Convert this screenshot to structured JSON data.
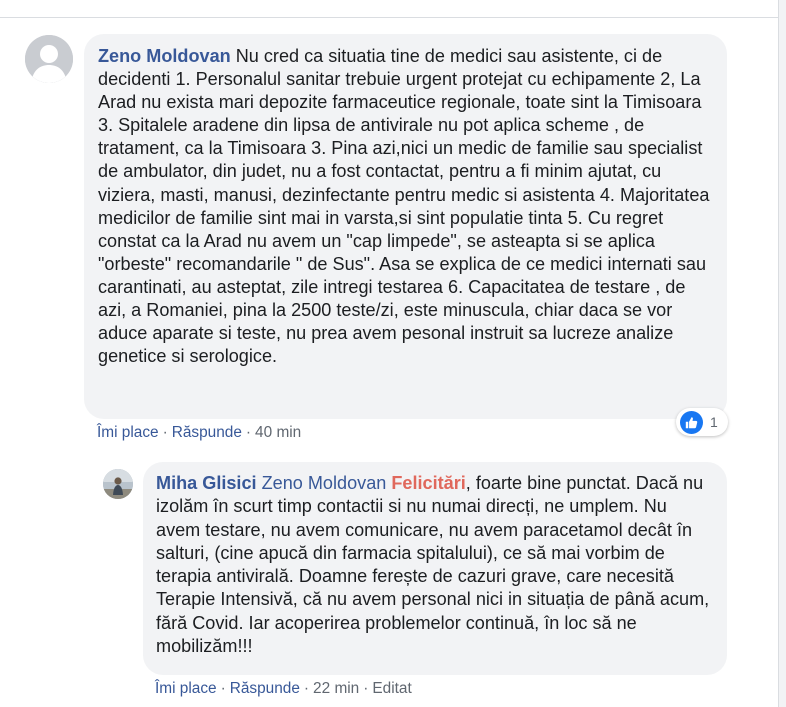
{
  "comment": {
    "author": "Zeno Moldovan",
    "text": "Nu cred ca situatia tine de medici sau asistente, ci de decidenti 1. Personalul sanitar trebuie urgent protejat cu echipamente 2, La Arad nu exista mari depozite farmaceutice regionale, toate sint la Timisoara 3. Spitalele aradene din lipsa de antivirale nu pot aplica scheme , de tratament, ca la Timisoara 3. Pina azi,nici un medic de familie sau specialist de ambulator, din judet, nu a fost contactat, pentru a fi minim ajutat, cu viziera, masti, manusi, dezinfectante pentru medic si asistenta 4. Majoritatea medicilor de familie sint mai in varsta,si sint populatie tinta 5. Cu regret constat ca la Arad nu avem un \"cap limpede\", se asteapta si se aplica \"orbeste\" recomandarile \" de Sus\". Asa se explica de ce medici internati sau carantinati, au asteptat, zile intregi testarea 6. Capacitatea de testare , de azi, a Romaniei, pina la 2500 teste/zi, este minuscula, chiar daca se vor aduce aparate si teste, nu prea avem pesonal instruit sa lucreze analize genetice si serologice.",
    "like_label": "Îmi place",
    "reply_label": "Răspunde",
    "separator": "·",
    "time": "40 min",
    "reaction_icon": "like-thumb-icon",
    "reaction_count": "1"
  },
  "reply": {
    "author": "Miha Glisici",
    "mention_user": "Zeno Moldovan",
    "mention_page": "Felicitări",
    "text": ", foarte bine punctat. Dacă nu izolăm în scurt timp contactii si nu numai direcți, ne umplem. Nu avem testare, nu avem comunicare, nu avem paracetamol decât în salturi, (cine apucă din farmacia spitalului), ce să mai vorbim de terapia antivirală. Doamne ferește de cazuri grave, care necesită Terapie Intensivă, că nu avem personal nici in situația de până acum, fără Covid. Iar acoperirea problemelor continuă, în loc să ne mobilizăm!!!",
    "like_label": "Îmi place",
    "reply_label": "Răspunde",
    "separator": "·",
    "time": "22 min",
    "edited_label": "Editat"
  },
  "colors": {
    "author": "#385898",
    "page_mention": "#e0685c",
    "bubble": "#f2f3f5",
    "text": "#1c1e21",
    "meta": "#606770",
    "like_blue": "#1877f2"
  }
}
